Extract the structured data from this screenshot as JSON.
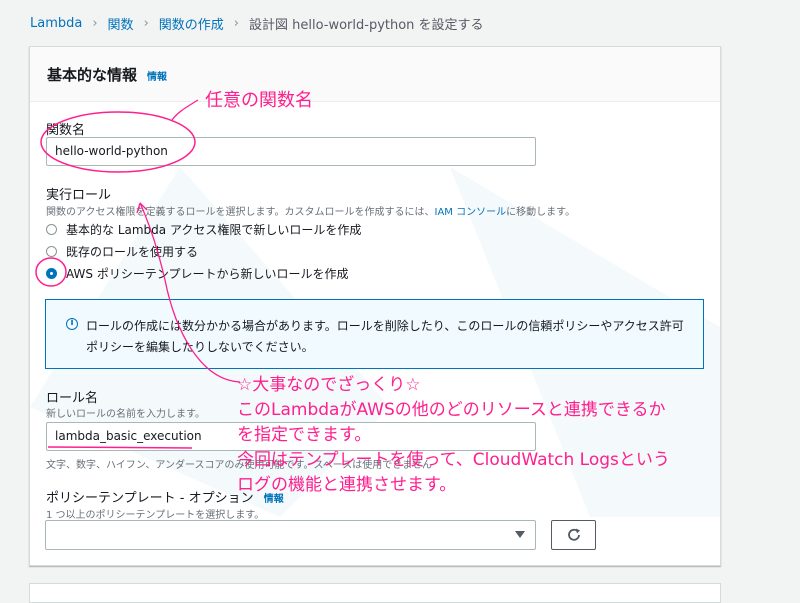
{
  "breadcrumb": {
    "items": [
      "Lambda",
      "関数",
      "関数の作成"
    ],
    "current": "設計図 hello-world-python を設定する"
  },
  "panel": {
    "title": "基本的な情報",
    "info": "情報"
  },
  "function_name": {
    "label": "関数名",
    "value": "hello-world-python"
  },
  "role": {
    "label": "実行ロール",
    "desc_before": "関数のアクセス権限を定義するロールを選択します。カスタムロールを作成するには、",
    "desc_link": "IAM コンソール",
    "desc_after": "に移動します。",
    "options": [
      {
        "label": "基本的な Lambda アクセス権限で新しいロールを作成",
        "selected": false
      },
      {
        "label": "既存のロールを使用する",
        "selected": false
      },
      {
        "label": "AWS ポリシーテンプレートから新しいロールを作成",
        "selected": true
      }
    ]
  },
  "alert": {
    "icon": "info-circle-icon",
    "text": "ロールの作成には数分かかる場合があります。ロールを削除したり、このロールの信頼ポリシーやアクセス許可ポリシーを編集したりしないでください。"
  },
  "role_name": {
    "label": "ロール名",
    "desc": "新しいロールの名前を入力します。",
    "value": "lambda_basic_execution",
    "hint": "文字、数字、ハイフン、アンダースコアのみ使用可能です。スペースは使用できません"
  },
  "policy": {
    "label": "ポリシーテンプレート - オプション",
    "info": "情報",
    "desc": "1 つ以上のポリシーテンプレートを選択します。",
    "selected_value": "",
    "refresh_icon": "refresh-icon"
  },
  "annotations": {
    "color": "#ff1f8e",
    "function_name_note": "任意の関数名",
    "main_note_lines": [
      "☆大事なのでざっくり☆",
      "このLambdaがAWSの他のどのリソースと連携できるか",
      "を指定できます。",
      "今回はテンプレートを使って、CloudWatch Logsという",
      "ログの機能と連携させます。"
    ]
  }
}
